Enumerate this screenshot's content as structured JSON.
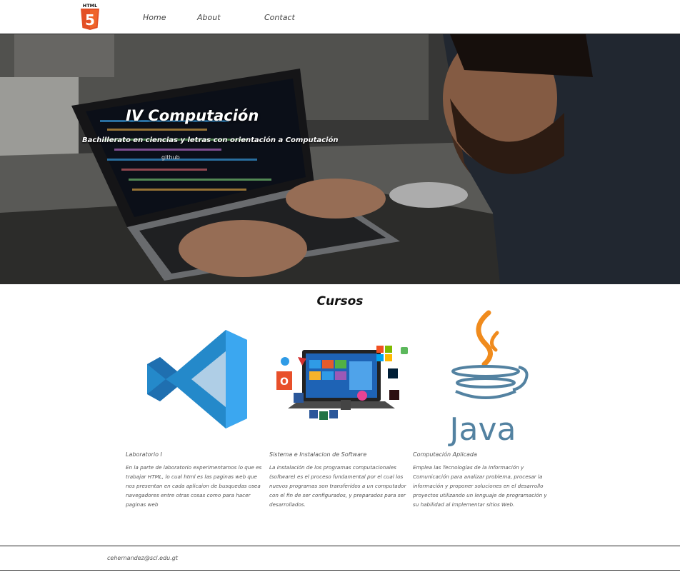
{
  "nav": {
    "logo_text": "HTML",
    "logo_number": "5",
    "links": [
      "Home",
      "About",
      "Contact"
    ]
  },
  "hero": {
    "title": "IV Computación",
    "subtitle": "Bachillerato en ciencias y letras con orientación a Computación",
    "link": "github"
  },
  "cursos": {
    "title": "Cursos",
    "cards": [
      {
        "icon": "vscode-logo",
        "title": "Laboratorio I",
        "description": "En la parte de laboratorio experimentamos lo que es trabajar HTML, lo cual html es las paginas web que nos presentan en cada aplicaion de busquedas osea navegadores entre otras cosas como para hacer paginas web"
      },
      {
        "icon": "software-install-laptop",
        "title": "Sistema e Instalacion de Software",
        "description": "La instalación de los programas computacionales (software) es el proceso fundamental por el cual los nuevos programas son transferidos a un computador con el fin de ser configurados, y preparados para ser desarrollados."
      },
      {
        "icon": "java-logo",
        "title": "Computación Aplicada",
        "description": "Emplea las Tecnologías de la Información y Comunicación para analizar problema, procesar la información y proponer soluciones en el desarrollo proyectos utilizando un lenguaje de programación y su habilidad al implementar sitios Web.",
        "logo_text": "Java"
      }
    ]
  },
  "footer": {
    "email": "cehernandez@scl.edu.gt"
  }
}
